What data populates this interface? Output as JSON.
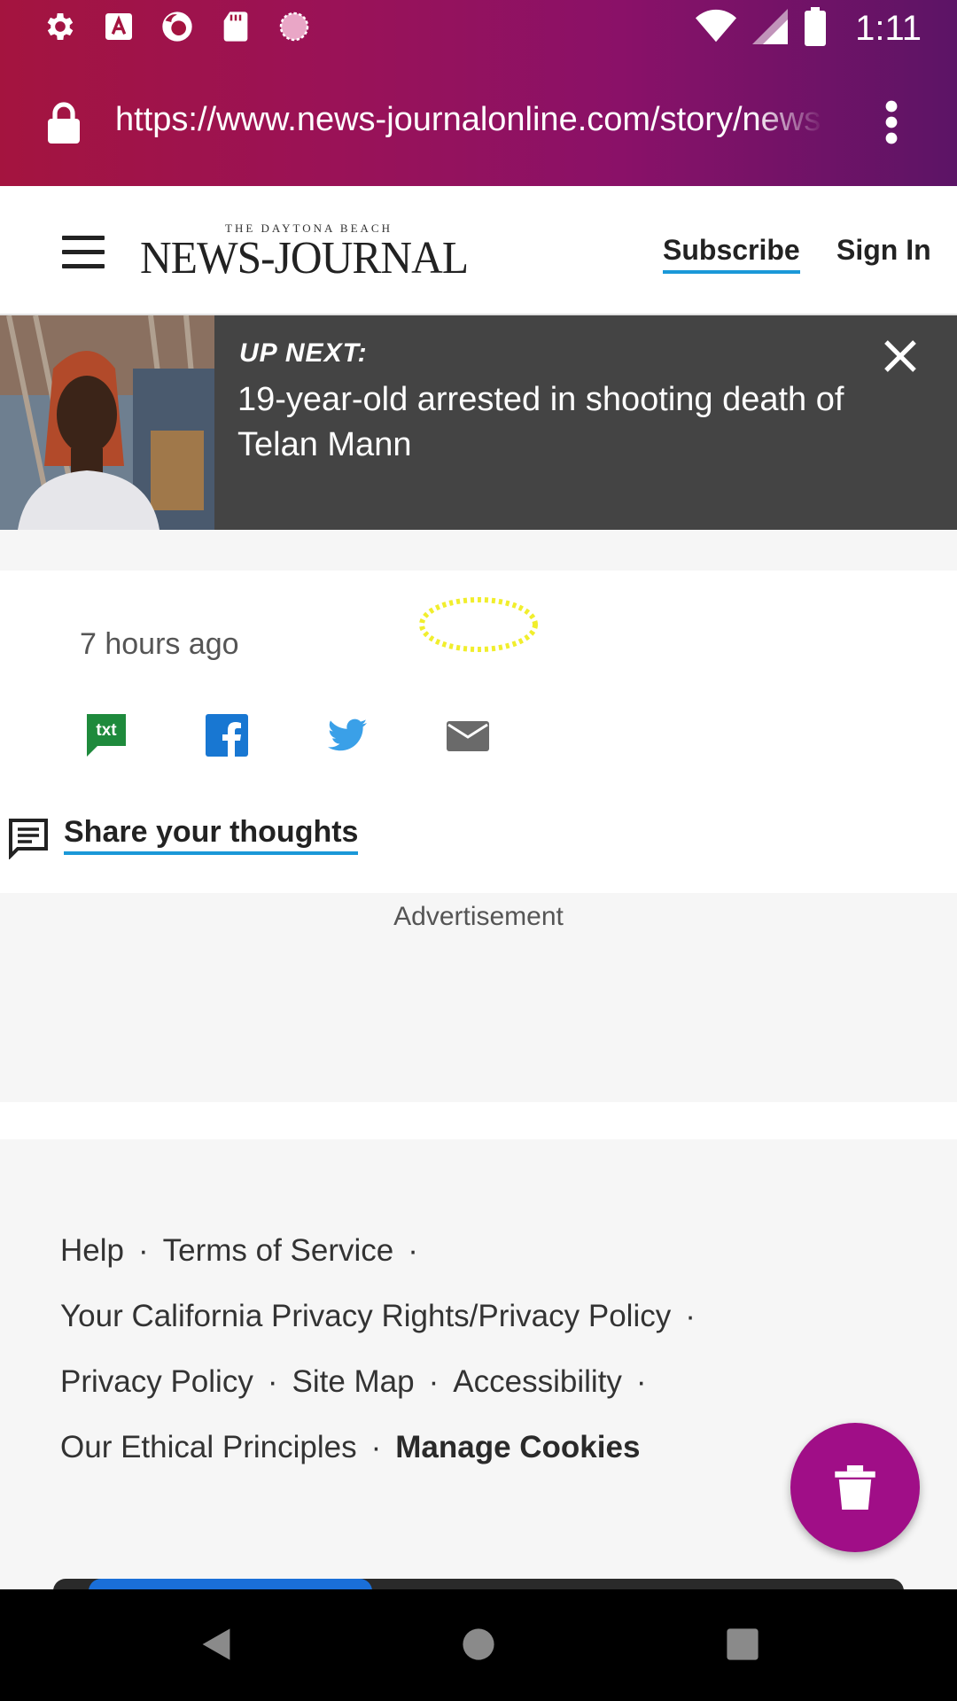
{
  "status_bar": {
    "time": "1:11",
    "left_icons": [
      "settings-icon",
      "text-a-icon",
      "firefox-icon",
      "sd-card-icon",
      "record-icon"
    ],
    "right_icons": [
      "wifi-icon",
      "signal-icon",
      "battery-icon"
    ]
  },
  "browser": {
    "url": "https://www.news-journalonline.com/story/news",
    "lock_icon": "lock-icon",
    "menu_icon": "kebab-menu-icon"
  },
  "site_header": {
    "logo_small": "THE DAYTONA BEACH",
    "logo_big": "NEWS-JOURNAL",
    "subscribe_label": "Subscribe",
    "signin_label": "Sign In"
  },
  "up_next": {
    "label": "UP NEXT:",
    "title": "19-year-old arrested in shooting death of Telan Mann"
  },
  "article": {
    "timestamp": "7 hours ago",
    "share_buttons": [
      "txt",
      "facebook",
      "twitter",
      "email"
    ],
    "share_txt_label": "txt",
    "comments_label": "Share your thoughts"
  },
  "ad": {
    "label": "Advertisement"
  },
  "footer": {
    "links": {
      "help": "Help",
      "terms": "Terms of Service",
      "california_privacy": "Your California Privacy Rights/Privacy Policy",
      "privacy": "Privacy Policy",
      "site_map": "Site Map",
      "accessibility": "Accessibility",
      "ethical": "Our Ethical Principles",
      "manage_cookies": "Manage Cookies"
    },
    "separator": "·"
  },
  "colors": {
    "browser_bar_start": "#a4143f",
    "browser_bar_end": "#5c1466",
    "accent_underline": "#1a98d8",
    "fab": "#a00e87",
    "up_next_bg": "#444444"
  }
}
